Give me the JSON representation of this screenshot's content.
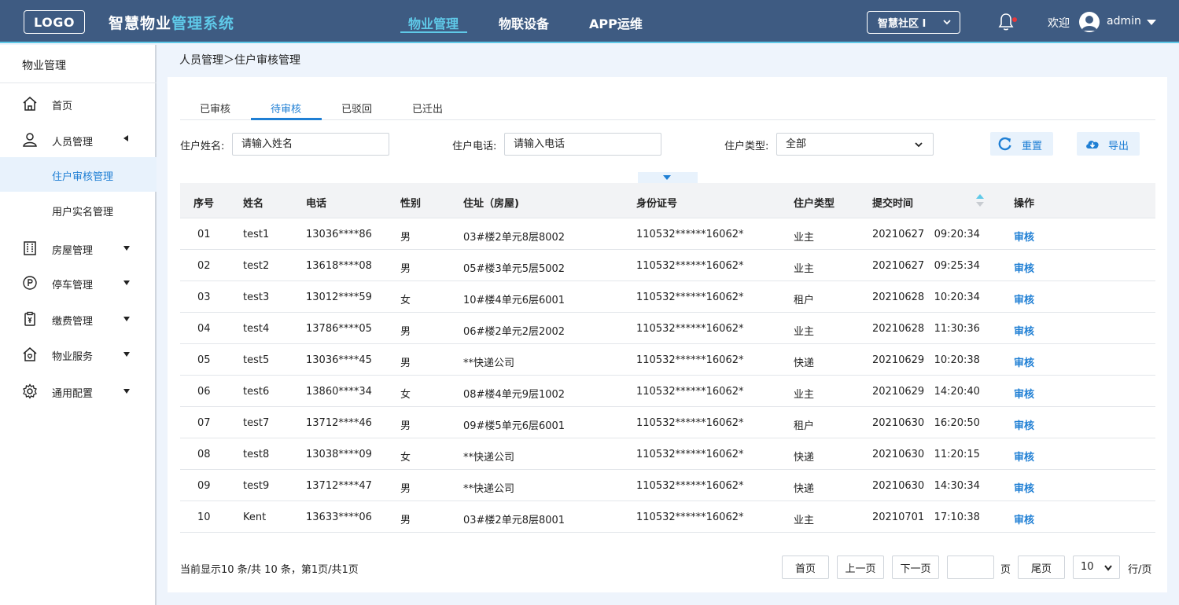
{
  "header": {
    "logo": "LOGO",
    "brand_part1": "智慧物业",
    "brand_part2": "管理系统",
    "nav": [
      "物业管理",
      "物联设备",
      "APP运维"
    ],
    "community": "智慧社区 I",
    "welcome": "欢迎",
    "username": "admin"
  },
  "sidebar": {
    "title": "物业管理",
    "items": {
      "home": "首页",
      "people": "人员管理",
      "audit": "住户审核管理",
      "realname": "用户实名管理",
      "house": "房屋管理",
      "parking": "停车管理",
      "fee": "缴费管理",
      "service": "物业服务",
      "config": "通用配置"
    }
  },
  "breadcrumb": "人员管理＞住户审核管理",
  "tabs": [
    "已审核",
    "待审核",
    "已驳回",
    "已迁出"
  ],
  "filters": {
    "name_label": "住户姓名:",
    "name_value": "请输入姓名",
    "phone_label": "住户电话:",
    "phone_value": "请输入电话",
    "type_label": "住户类型:",
    "type_value": "全部",
    "reset": "重置",
    "export": "导出"
  },
  "table": {
    "headers": [
      "序号",
      "姓名",
      "电话",
      "性别",
      "住址（房屋)",
      "身份证号",
      "住户类型",
      "提交时间",
      "操作"
    ],
    "rows": [
      {
        "no": "01",
        "name": "test1",
        "phone": "13036****86",
        "gender": "男",
        "addr": "03#楼2单元8层8002",
        "id": "110532******16062*",
        "type": "业主",
        "time": "20210627   09:20:34",
        "op": "审核"
      },
      {
        "no": "02",
        "name": "test2",
        "phone": "13618****08",
        "gender": "男",
        "addr": "05#楼3单元5层5002",
        "id": "110532******16062*",
        "type": "业主",
        "time": "20210627   09:25:34",
        "op": "审核"
      },
      {
        "no": "03",
        "name": "test3",
        "phone": "13012****59",
        "gender": "女",
        "addr": "10#楼4单元6层6001",
        "id": "110532******16062*",
        "type": "租户",
        "time": "20210628   10:20:34",
        "op": "审核"
      },
      {
        "no": "04",
        "name": "test4",
        "phone": "13786****05",
        "gender": "男",
        "addr": "06#楼2单元2层2002",
        "id": "110532******16062*",
        "type": "业主",
        "time": "20210628   11:30:36",
        "op": "审核"
      },
      {
        "no": "05",
        "name": "test5",
        "phone": "13036****45",
        "gender": "男",
        "addr": "**快递公司",
        "id": "110532******16062*",
        "type": "快递",
        "time": "20210629   10:20:38",
        "op": "审核"
      },
      {
        "no": "06",
        "name": "test6",
        "phone": "13860****34",
        "gender": "女",
        "addr": "08#楼4单元9层1002",
        "id": "110532******16062*",
        "type": "业主",
        "time": "20210629   14:20:40",
        "op": "审核"
      },
      {
        "no": "07",
        "name": "test7",
        "phone": "13712****46",
        "gender": "男",
        "addr": "09#楼5单元6层6001",
        "id": "110532******16062*",
        "type": "租户",
        "time": "20210630   16:20:50",
        "op": "审核"
      },
      {
        "no": "08",
        "name": "test8",
        "phone": "13038****09",
        "gender": "女",
        "addr": "**快递公司",
        "id": "110532******16062*",
        "type": "快递",
        "time": "20210630   11:20:15",
        "op": "审核"
      },
      {
        "no": "09",
        "name": "test9",
        "phone": "13712****47",
        "gender": "男",
        "addr": "**快递公司",
        "id": "110532******16062*",
        "type": "快递",
        "time": "20210630   14:30:34",
        "op": "审核"
      },
      {
        "no": "10",
        "name": "Kent",
        "phone": "13633****06",
        "gender": "男",
        "addr": "03#楼2单元8层8001",
        "id": "110532******16062*",
        "type": "业主",
        "time": "20210701   17:10:38",
        "op": "审核"
      }
    ]
  },
  "pagination": {
    "info": "当前显示10 条/共 10 条，第1页/共1页",
    "first": "首页",
    "prev": "上一页",
    "next": "下一页",
    "page_unit": "页",
    "last": "尾页",
    "page_size": "10",
    "size_unit": "行/页"
  }
}
